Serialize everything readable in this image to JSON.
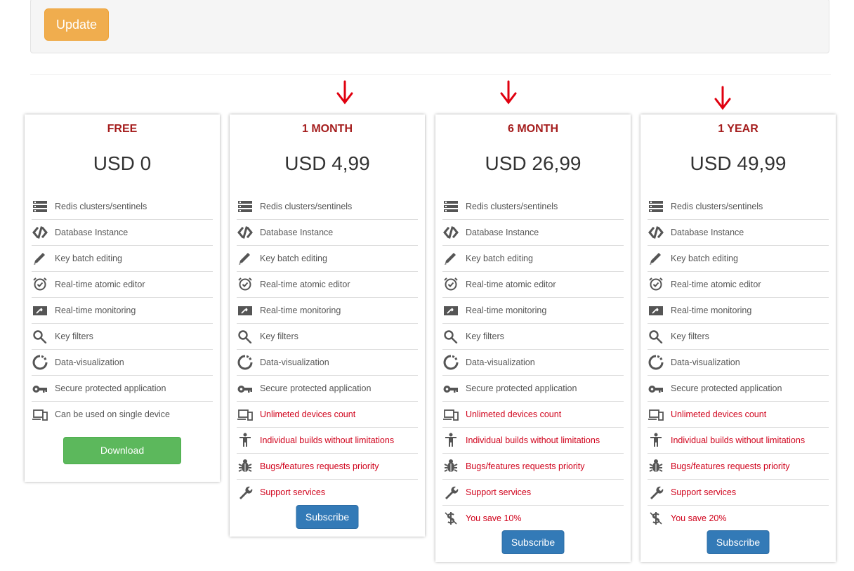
{
  "update_label": "Update",
  "colors": {
    "accent_red": "#a51d1d",
    "pro_feature_red": "#d0021b",
    "arrow_red": "#e0000f",
    "warning": "#f0ad4e",
    "success": "#5cb85c",
    "primary": "#337ab7"
  },
  "feature_labels": {
    "clusters": "Redis clusters/sentinels",
    "database": "Database Instance",
    "batch": "Key batch editing",
    "atomic": "Real-time atomic editor",
    "monitoring": "Real-time monitoring",
    "filters": "Key filters",
    "visualization": "Data-visualization",
    "secure": "Secure protected application",
    "single": "Can be used on single device",
    "unlimited": "Unlimeted devices count",
    "builds": "Individual builds without limitations",
    "bugs": "Bugs/features requests priority",
    "support": "Support services"
  },
  "plans": [
    {
      "title": "FREE",
      "price": "USD 0",
      "button": "Download"
    },
    {
      "title": "1 MONTH",
      "price": "USD 4,99",
      "button": "Subscribe"
    },
    {
      "title": "6 MONTH",
      "price": "USD 26,99",
      "button": "Subscribe",
      "save": "You save 10%"
    },
    {
      "title": "1 YEAR",
      "price": "USD 49,99",
      "button": "Subscribe",
      "save": "You save 20%"
    }
  ]
}
